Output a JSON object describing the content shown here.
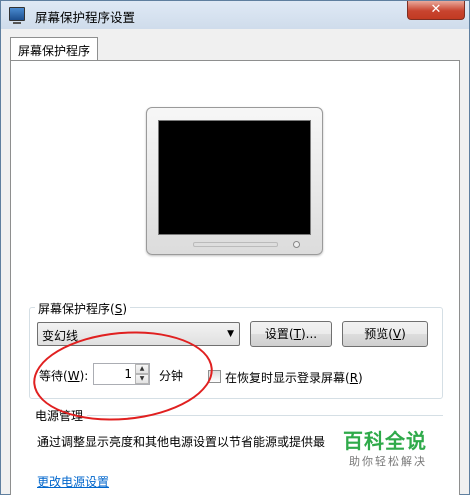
{
  "window": {
    "title": "屏幕保护程序设置",
    "close_glyph": "✕"
  },
  "tabs": [
    {
      "label": "屏幕保护程序",
      "selected": true
    }
  ],
  "preview": {
    "screen_color": "#000000"
  },
  "screensaver": {
    "group_label": "屏幕保护程序(S)",
    "selected": "变幻线",
    "settings_button": "设置(T)...",
    "preview_button": "预览(V)",
    "wait_label": "等待(W):",
    "wait_value": "1",
    "wait_unit": "分钟",
    "resume_checkbox_label": "在恢复时显示登录屏幕(R)",
    "resume_checked": false
  },
  "power": {
    "title": "电源管理",
    "description": "通过调整显示亮度和其他电源设置以节省能源或提供最",
    "link": "更改电源设置"
  },
  "annotation": {
    "color": "#e02020"
  },
  "watermark": {
    "brand": "百科全说",
    "slogan": "助你轻松解决"
  }
}
